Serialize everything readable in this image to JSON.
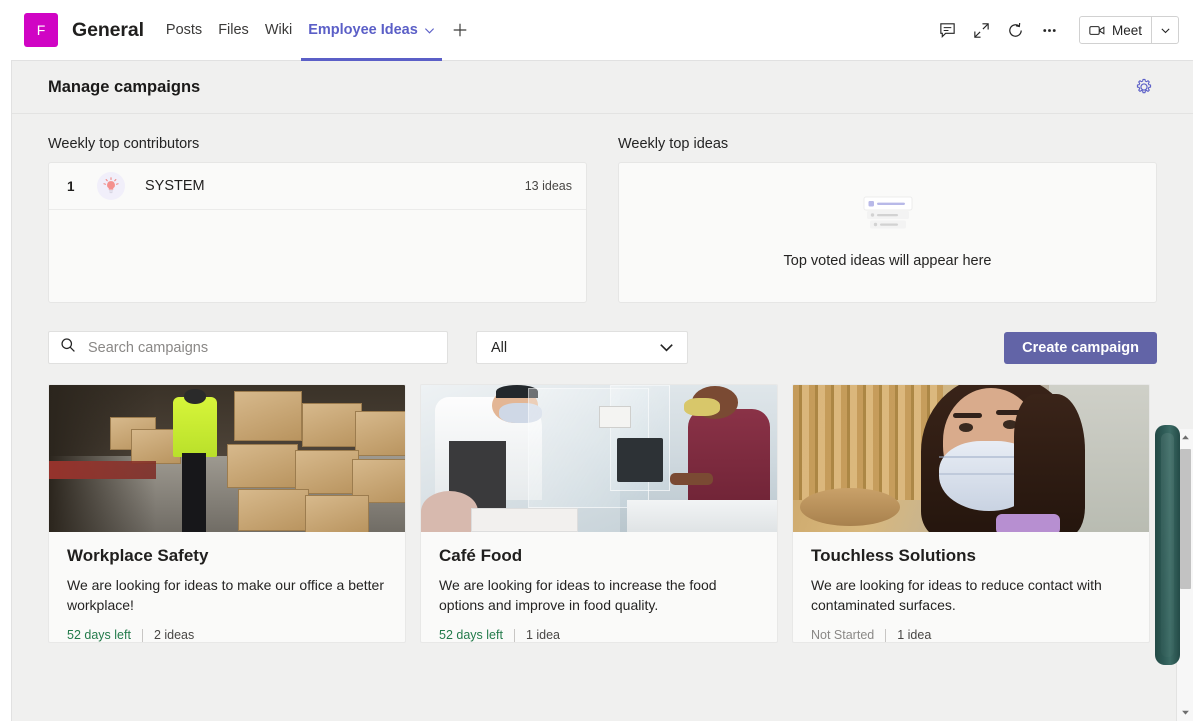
{
  "topbar": {
    "team_avatar_letter": "F",
    "team_avatar_color": "#d004c4",
    "team_name": "General",
    "tabs": [
      {
        "label": "Posts",
        "active": false
      },
      {
        "label": "Files",
        "active": false
      },
      {
        "label": "Wiki",
        "active": false
      },
      {
        "label": "Employee Ideas",
        "active": true
      }
    ],
    "add_tab_label": "+",
    "icons": [
      "chat-icon",
      "expand-icon",
      "refresh-icon",
      "more-options-icon"
    ],
    "meet_label": "Meet",
    "accent_color": "#5b5fc7"
  },
  "panel": {
    "title": "Manage campaigns",
    "settings_icon": "gear-icon"
  },
  "widgets": {
    "contributors": {
      "label": "Weekly top contributors",
      "rows": [
        {
          "rank": "1",
          "avatar_icon": "lightbulb-icon",
          "name": "SYSTEM",
          "count": "13 ideas"
        }
      ]
    },
    "ideas": {
      "label": "Weekly top ideas",
      "empty_icon": "list-placeholder-icon",
      "empty_text": "Top voted ideas will appear here"
    }
  },
  "toolbar": {
    "search_placeholder": "Search campaigns",
    "search_value": "",
    "search_icon": "search-icon",
    "filter_value": "All",
    "filter_caret_icon": "chevron-down-icon",
    "create_label": "Create campaign",
    "create_color": "#6264a7"
  },
  "cards": [
    {
      "image": "warehouse-worker-boxes-photo",
      "title": "Workplace Safety",
      "description": "We are looking for ideas to make our office a better workplace!",
      "status": "52 days left",
      "status_active": true,
      "ideas": "2 ideas"
    },
    {
      "image": "cafe-counter-masked-staff-photo",
      "title": "Café Food",
      "description": "We are looking for ideas to increase the food options and improve in food quality.",
      "status": "52 days left",
      "status_active": true,
      "ideas": "1 idea"
    },
    {
      "image": "woman-wearing-face-mask-photo",
      "title": "Touchless Solutions",
      "description": "We are looking for ideas to reduce contact with contaminated surfaces.",
      "status": "Not Started",
      "status_active": false,
      "ideas": "1 idea"
    }
  ],
  "scrollbars": {
    "inner_up_icon": "scroll-up-arrow-icon",
    "inner_down_icon": "scroll-down-arrow-icon",
    "outer_thumb_color": "#2e5b56"
  }
}
